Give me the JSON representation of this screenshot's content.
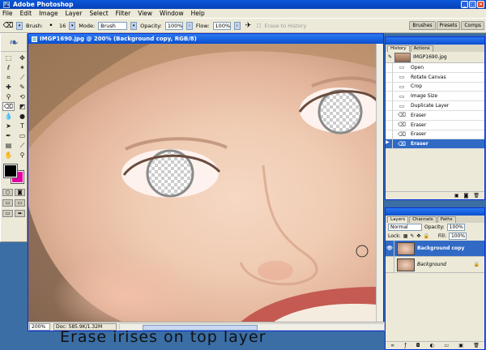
{
  "app": {
    "title": "Adobe Photoshop"
  },
  "menu": [
    "File",
    "Edit",
    "Image",
    "Layer",
    "Select",
    "Filter",
    "View",
    "Window",
    "Help"
  ],
  "options": {
    "brush_label": "Brush:",
    "brush_size": "16",
    "mode_label": "Mode:",
    "mode_value": "Brush",
    "opacity_label": "Opacity:",
    "opacity_value": "100%",
    "flow_label": "Flow:",
    "flow_value": "100%",
    "erase_history": "Erase to History",
    "well_tabs": [
      "Brushes",
      "Presets",
      "Comps"
    ]
  },
  "document": {
    "title": "IMGP1690.jpg @ 200% (Background copy, RGB/8)",
    "zoom": "200%",
    "doc_info": "Doc: 585.9K/1.32M"
  },
  "caption": "Erase irises on top layer",
  "history": {
    "tabs": [
      "History",
      "Actions"
    ],
    "snapshot": "IMGP1690.jpg",
    "states": [
      {
        "label": "Open",
        "icon": "doc-icon"
      },
      {
        "label": "Rotate Canvas",
        "icon": "doc-icon"
      },
      {
        "label": "Crop",
        "icon": "doc-icon"
      },
      {
        "label": "Image Size",
        "icon": "doc-icon"
      },
      {
        "label": "Duplicate Layer",
        "icon": "doc-icon"
      },
      {
        "label": "Eraser",
        "icon": "eraser-icon"
      },
      {
        "label": "Eraser",
        "icon": "eraser-icon"
      },
      {
        "label": "Eraser",
        "icon": "eraser-icon"
      },
      {
        "label": "Eraser",
        "icon": "eraser-icon",
        "active": true
      }
    ]
  },
  "layers": {
    "tabs": [
      "Layers",
      "Channels",
      "Paths"
    ],
    "blend_mode": "Normal",
    "opacity_label": "Opacity:",
    "opacity": "100%",
    "lock_label": "Lock:",
    "fill_label": "Fill:",
    "fill": "100%",
    "items": [
      {
        "name": "Background copy",
        "active": true
      },
      {
        "name": "Background",
        "active": false
      }
    ]
  }
}
